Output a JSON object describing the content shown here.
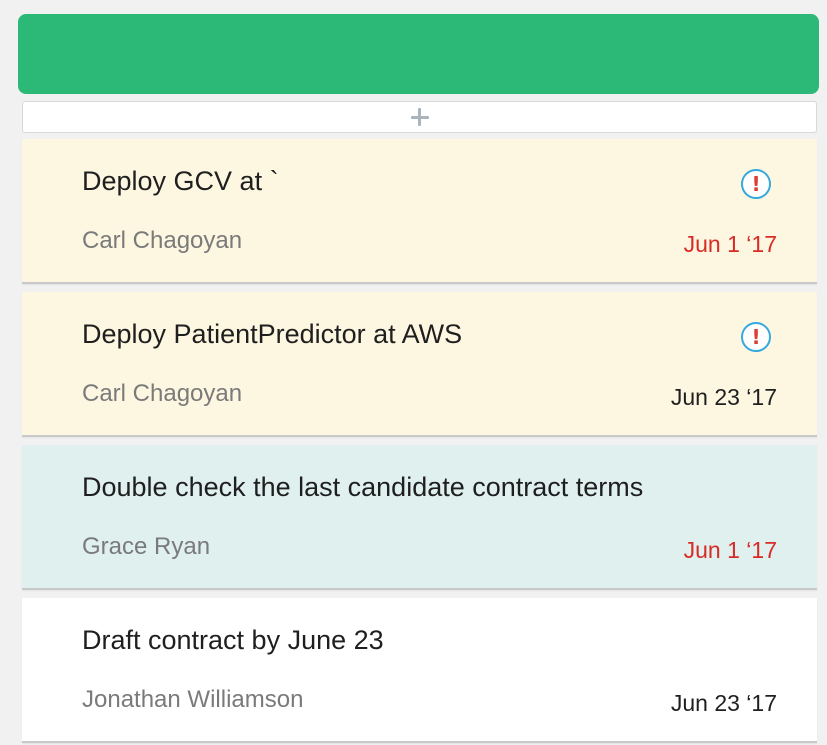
{
  "colors": {
    "header": "#2cb978",
    "card_yellow": "#fdf7e1",
    "card_teal": "#dff0ef",
    "card_white": "#ffffff",
    "overdue": "#d92b26",
    "normal_date": "#1f1f1f"
  },
  "add_row": {
    "icon": "plus-icon"
  },
  "cards": [
    {
      "title": "Deploy GCV at `",
      "assignee": "Carl Chagoyan",
      "date": "Jun 1 ‘17",
      "date_status": "overdue",
      "flagged": true,
      "bg": "#fdf7e1",
      "alert_glyph": "!"
    },
    {
      "title": "Deploy PatientPredictor at AWS",
      "assignee": "Carl Chagoyan",
      "date": "Jun 23 ‘17",
      "date_status": "normal",
      "flagged": true,
      "bg": "#fdf7e1",
      "alert_glyph": "!"
    },
    {
      "title": "Double check the last candidate contract terms",
      "assignee": "Grace Ryan",
      "date": "Jun 1 ‘17",
      "date_status": "overdue",
      "flagged": false,
      "bg": "#dff0ef"
    },
    {
      "title": "Draft contract by June 23",
      "assignee": "Jonathan Williamson",
      "date": "Jun 23 ‘17",
      "date_status": "normal",
      "flagged": false,
      "bg": "#ffffff"
    }
  ]
}
